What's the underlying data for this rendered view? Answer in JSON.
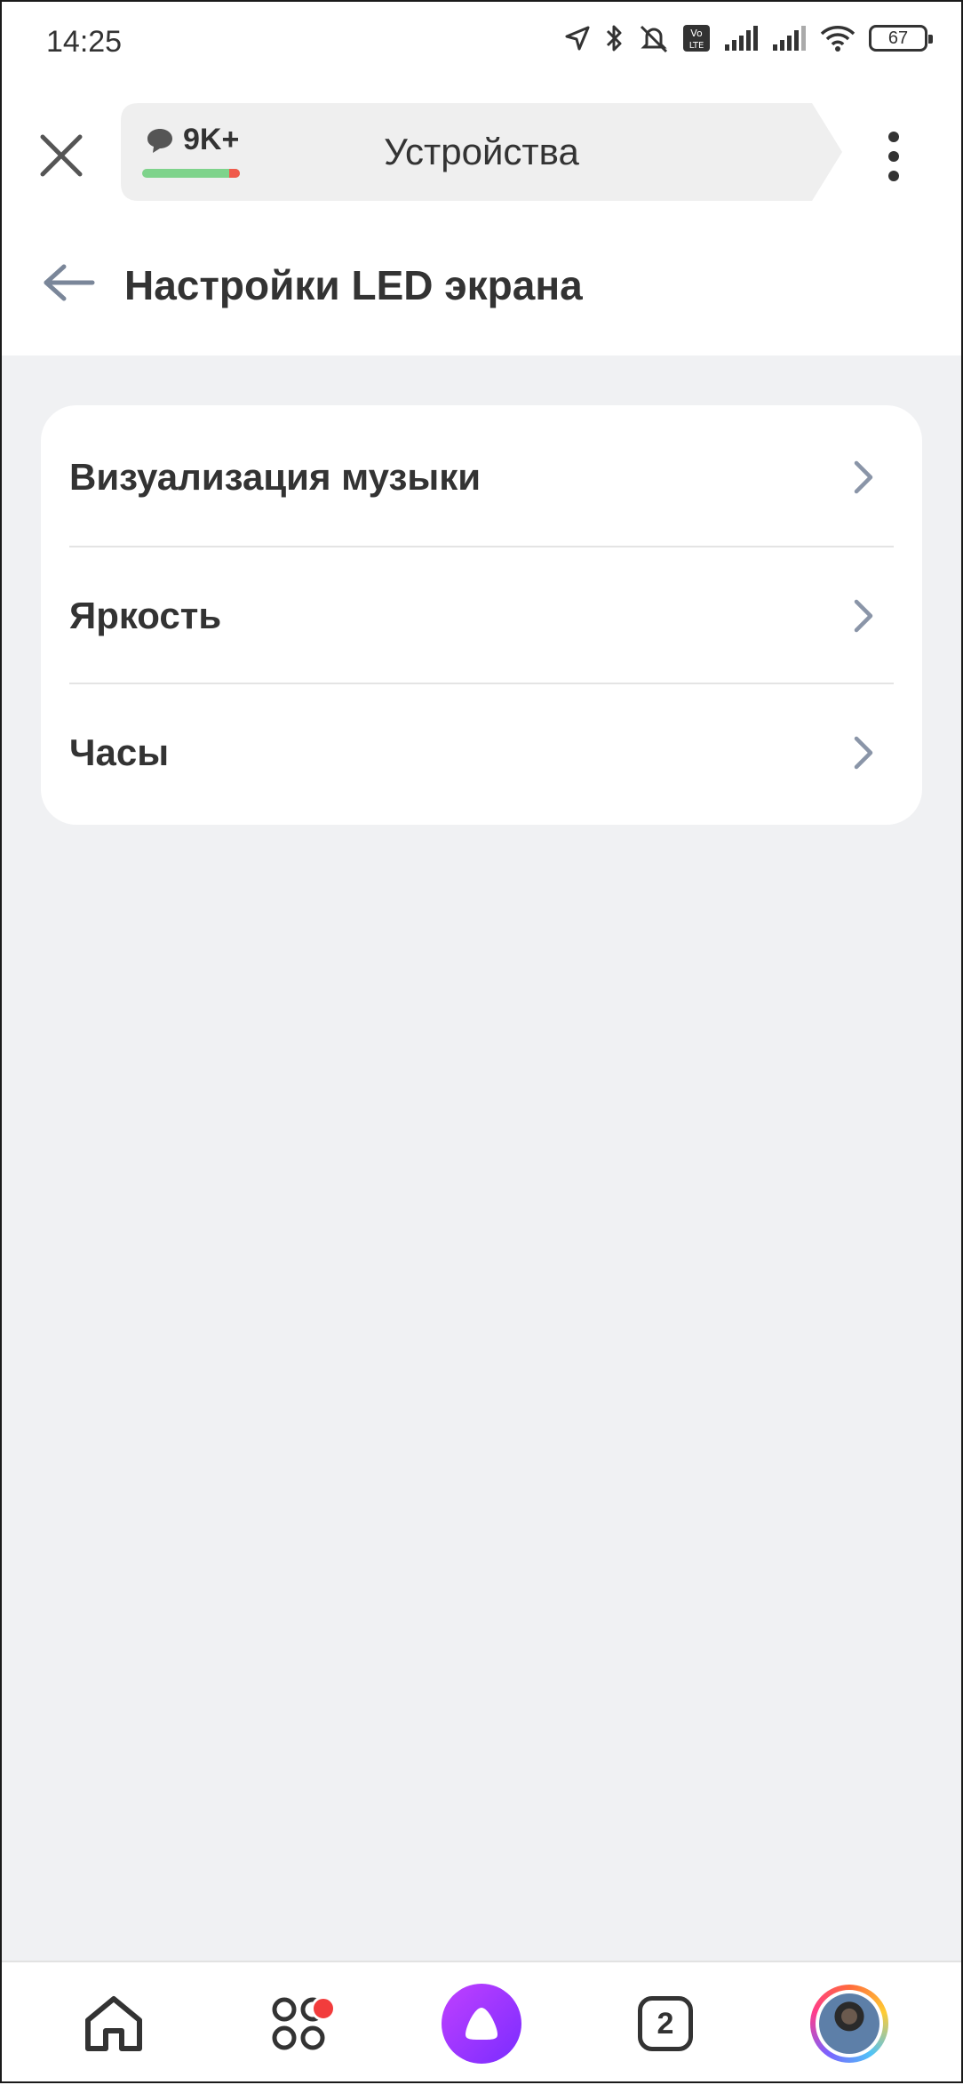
{
  "status_bar": {
    "time": "14:25",
    "battery": "67"
  },
  "browser": {
    "comments_count": "9K+",
    "tab_title": "Устройства"
  },
  "page": {
    "title": "Настройки LED экрана"
  },
  "settings": {
    "items": [
      {
        "label": "Визуализация музыки"
      },
      {
        "label": "Яркость"
      },
      {
        "label": "Часы"
      }
    ]
  },
  "bottom_nav": {
    "tabs_count": "2"
  },
  "colors": {
    "text": "#333333",
    "background": "#f0f1f3",
    "accent_purple": "#a233ff",
    "badge_red": "#f23c3c"
  },
  "icons": [
    "location-icon",
    "bluetooth-icon",
    "muted-bell-icon",
    "volte-icon",
    "signal-icon",
    "wifi-icon",
    "battery-icon",
    "close-icon",
    "comment-icon",
    "kebab-menu-icon",
    "back-arrow-icon",
    "chevron-right-icon",
    "home-icon",
    "services-icon",
    "alice-icon",
    "tabs-icon",
    "avatar"
  ]
}
